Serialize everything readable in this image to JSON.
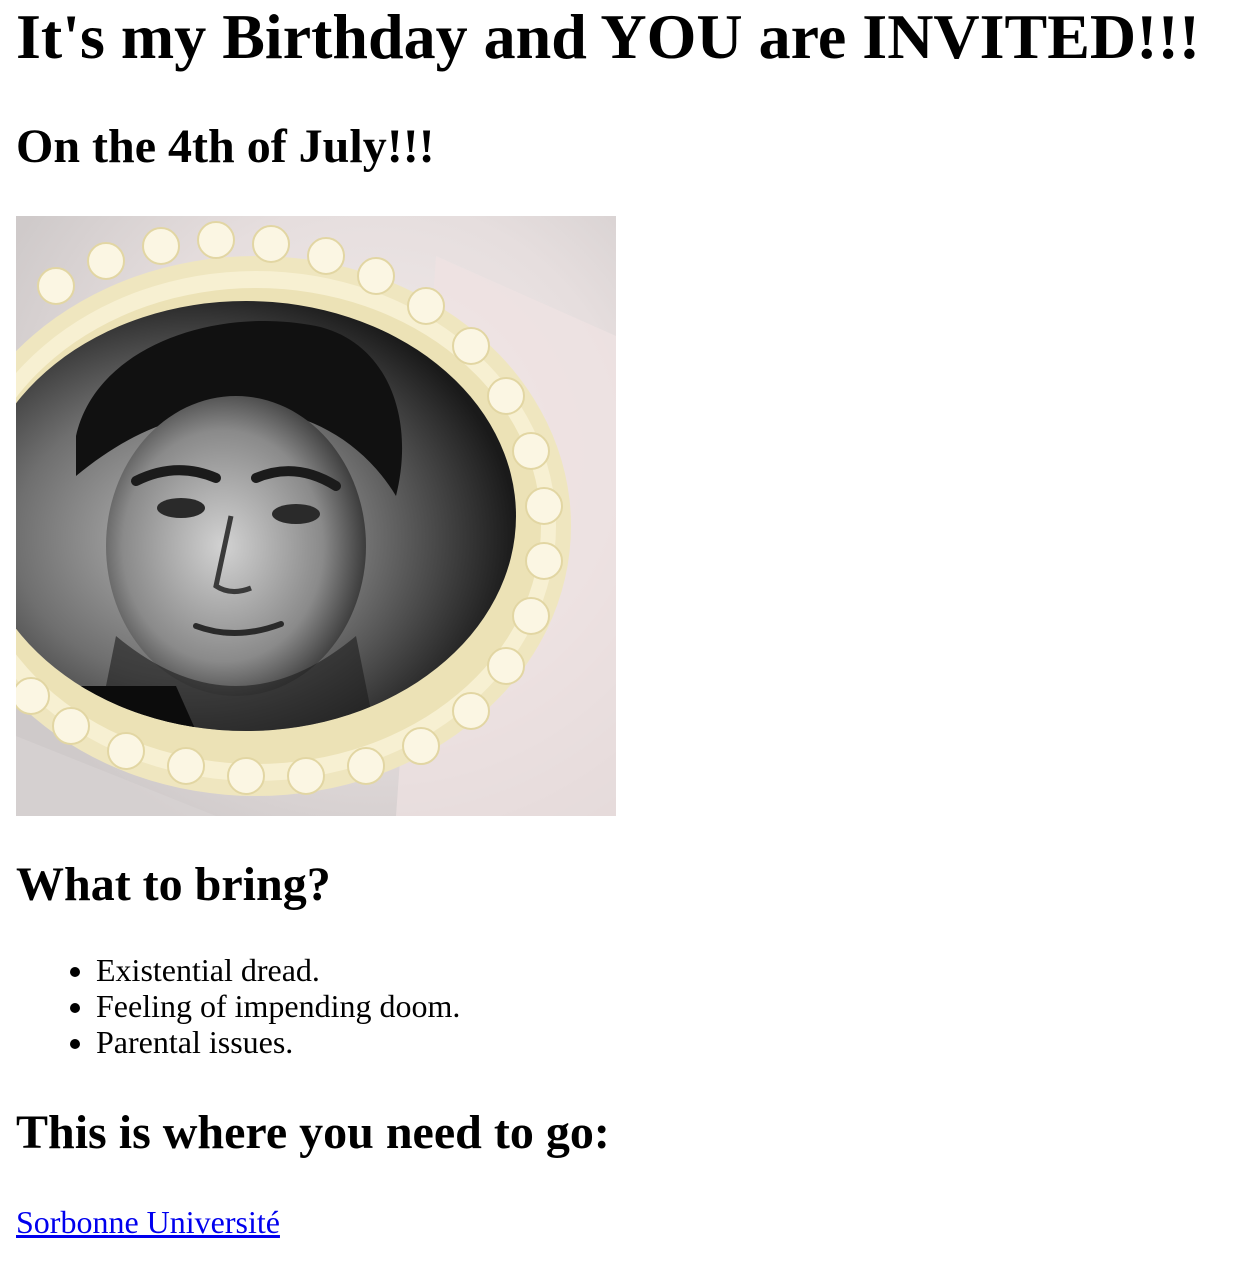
{
  "invite": {
    "title": "It's my Birthday and YOU are INVITED!!!",
    "date_heading": "On the 4th of July!!!",
    "bring_heading": "What to bring?",
    "bring_items": [
      "Existential dread.",
      "Feeling of impending doom.",
      "Parental issues."
    ],
    "location_heading": "This is where you need to go:",
    "location_link": "Sorbonne Université"
  },
  "colors": {
    "link": "#0000ee",
    "text": "#000000",
    "background": "#ffffff"
  }
}
